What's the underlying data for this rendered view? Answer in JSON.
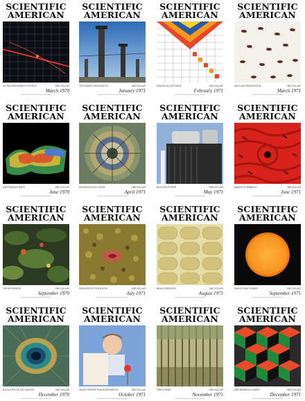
{
  "masthead": {
    "line1": "SCIENTIFIC",
    "line2": "AMERICAN"
  },
  "covers": [
    {
      "id": "c1",
      "date": "March 1970",
      "caption": "ULTRA-HIGH-ENERGY PHYSICS",
      "price": "ONE DOLLAR"
    },
    {
      "id": "c2",
      "date": "January 1971",
      "caption": "THE ENERGY RESOURCES",
      "price": "ONE DOLLAR"
    },
    {
      "id": "c3",
      "date": "February 1971",
      "caption": "GRAPHICAL PATTERNS",
      "price": "ONE DOLLAR"
    },
    {
      "id": "c4",
      "date": "March 1971",
      "caption": "ANTS AND ORIENTATION",
      "price": "ONE DOLLAR"
    },
    {
      "id": "c5",
      "date": "June 1970",
      "caption": "EARTHQUAKE MAPS",
      "price": "ONE DOLLAR"
    },
    {
      "id": "c6",
      "date": "April 1971",
      "caption": "KALEIDOSCOPIC VISION",
      "price": "ONE DOLLAR"
    },
    {
      "id": "c7",
      "date": "May 1971",
      "caption": "NUCLEAR POWER",
      "price": "ONE DOLLAR"
    },
    {
      "id": "c8",
      "date": "June 1971",
      "caption": "MAGNETIC BUBBLES",
      "price": "ONE DOLLAR"
    },
    {
      "id": "c9",
      "date": "September 1970",
      "caption": "THE BIOSPHERE",
      "price": "ONE DOLLAR"
    },
    {
      "id": "c10",
      "date": "July 1971",
      "caption": "PARASITES IN THE BLOOD",
      "price": "ONE DOLLAR"
    },
    {
      "id": "c11",
      "date": "August 1971",
      "caption": "BRAIN SURFACES",
      "price": "ONE DOLLAR"
    },
    {
      "id": "c12",
      "date": "September 1971",
      "caption": "ENERGY AND POWER",
      "price": "ONE DOLLAR"
    },
    {
      "id": "c13",
      "date": "December 1970",
      "caption": "EVOLUTION OF COLORATION",
      "price": "ONE DOLLAR"
    },
    {
      "id": "c14",
      "date": "October 1971",
      "caption": "INFANT PERCEPTION EXPERIMENTS",
      "price": "ONE DOLLAR"
    },
    {
      "id": "c15",
      "date": "November 1971",
      "caption": "TREE FARMS",
      "price": "ONE DOLLAR"
    },
    {
      "id": "c16",
      "date": "December 1971",
      "caption": "MATHEMATICAL GAMES",
      "price": "ONE DOLLAR"
    }
  ],
  "colors": {
    "c1": "#0c0e14",
    "c2": "#4e86c8",
    "c3": "#ffffff",
    "c4": "#f4f1ea",
    "c5": "#000000",
    "c6": "#6b7b61",
    "c7": "#8fb1d9",
    "c8": "#d8231d",
    "c9": "#2c3a22",
    "c10": "#8a7a31",
    "c11": "#d9cf95",
    "c12": "#0a0a0a",
    "c13": "#4a6b58",
    "c14": "#7ca4d8",
    "c15": "#b7b486",
    "c16": "#2a2a2a"
  }
}
